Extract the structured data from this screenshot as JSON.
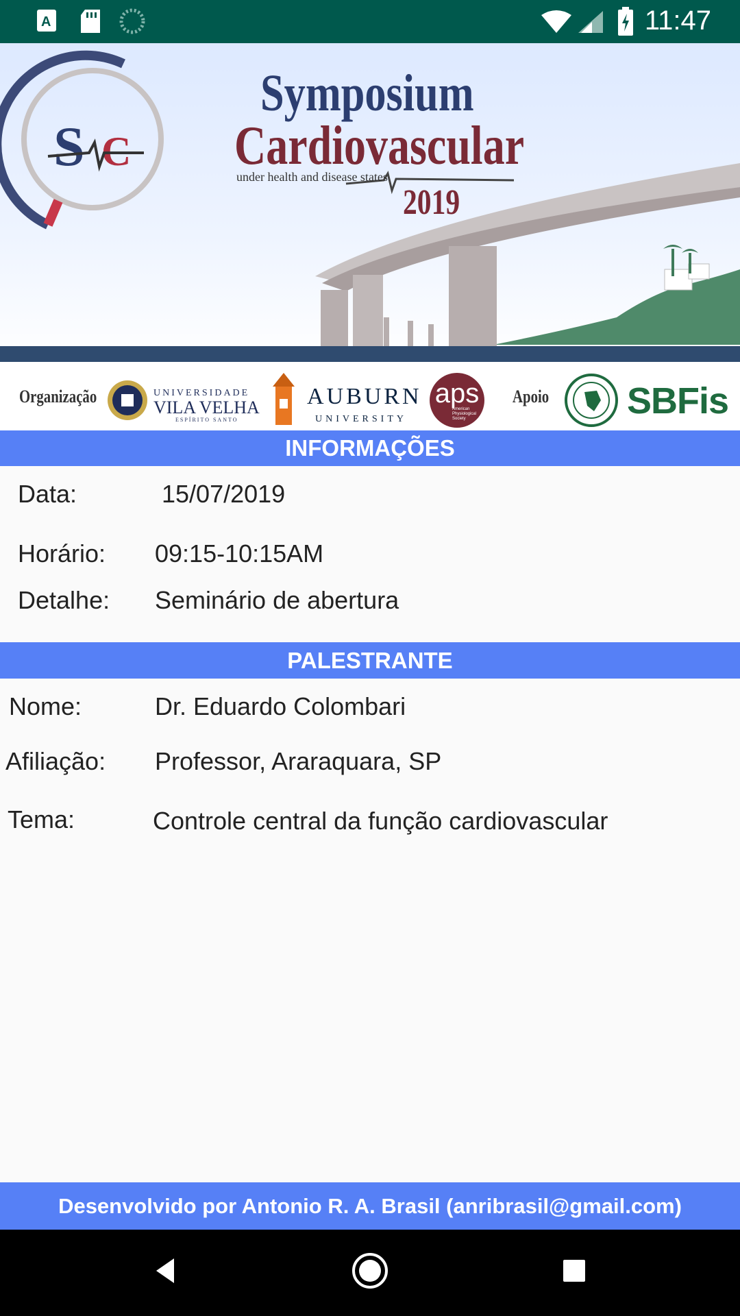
{
  "status_bar": {
    "time": "11:47",
    "left_icons": [
      "a-icon",
      "sd-card-icon",
      "sync-icon"
    ],
    "right_icons": [
      "wifi-icon",
      "signal-icon",
      "battery-charging-icon"
    ]
  },
  "banner": {
    "title_line1": "Symposium",
    "title_line2": "Cardiovascular",
    "subtitle": "under health and disease states",
    "year": "2019",
    "logo_text": "SC"
  },
  "sponsors": {
    "organizacao_label": "Organização",
    "uvv_line1": "UNIVERSIDADE",
    "uvv_line2": "VILA VELHA",
    "uvv_line3": "ESPÍRITO SANTO",
    "auburn_line1": "AUBURN",
    "auburn_line2": "UNIVERSITY",
    "aps": "aps",
    "aps_sub": "American Physiological Society",
    "apoio_label": "Apoio",
    "sbfis": "SBFis"
  },
  "informacoes": {
    "header": "INFORMAÇÕES",
    "data_label": "Data:",
    "data_value": "15/07/2019",
    "horario_label": "Horário:",
    "horario_value": "09:15-10:15AM",
    "detalhe_label": "Detalhe:",
    "detalhe_value": "Seminário de abertura"
  },
  "palestrante": {
    "header": "PALESTRANTE",
    "nome_label": "Nome:",
    "nome_value": "Dr. Eduardo Colombari",
    "afiliacao_label": "Afiliação:",
    "afiliacao_value": "Professor, Araraquara, SP",
    "tema_label": "Tema:",
    "tema_value": "Controle central da função cardiovascular"
  },
  "footer": {
    "text": "Desenvolvido por Antonio R. A. Brasil (anribrasil@gmail.com)"
  },
  "nav": {
    "icons": [
      "back-icon",
      "home-icon",
      "recents-icon"
    ]
  },
  "colors": {
    "status_bar": "#00594d",
    "accent": "#5680f6",
    "title_navy": "#2c3e70",
    "title_maroon": "#7a2a36"
  }
}
